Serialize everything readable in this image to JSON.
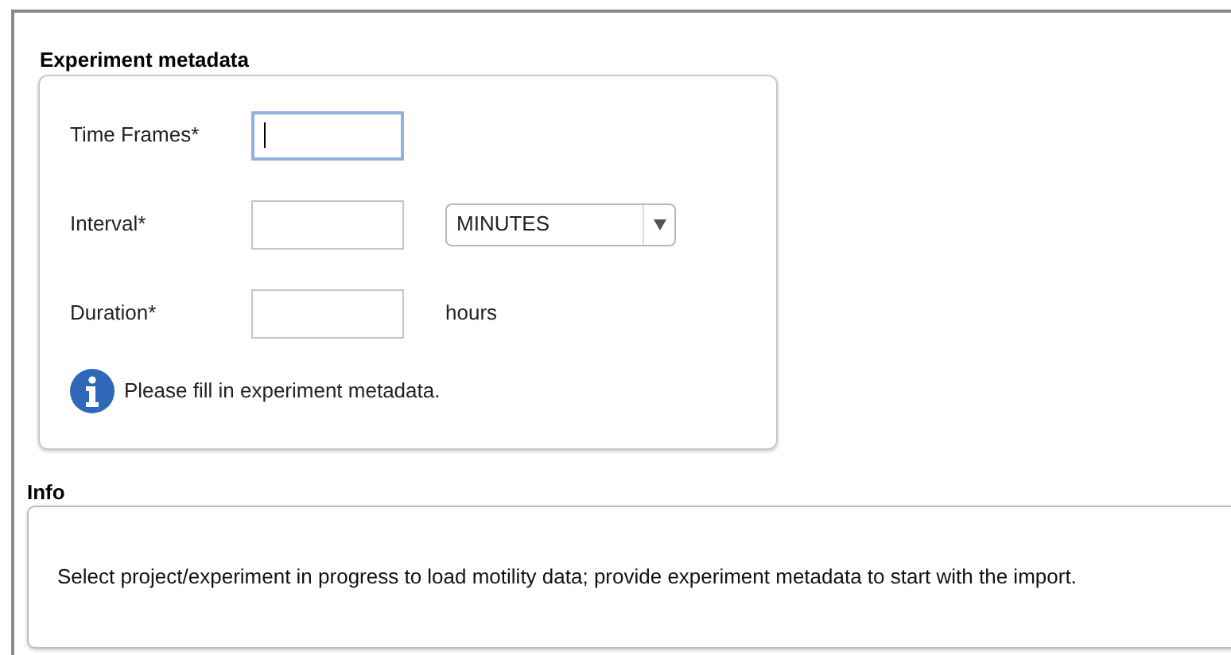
{
  "experiment_metadata": {
    "title": "Experiment metadata",
    "fields": [
      {
        "kind": "text",
        "label": "Time Frames*",
        "focused": true
      },
      {
        "kind": "text_select",
        "label": "Interval*",
        "focused": false,
        "select_value": "MINUTES"
      },
      {
        "kind": "text_unit",
        "label": "Duration*",
        "focused": false,
        "unit": "hours"
      }
    ],
    "message": "Please fill in experiment metadata."
  },
  "info": {
    "title": "Info",
    "text": "Select project/experiment in progress to load motility data; provide experiment metadata to start with the import."
  }
}
